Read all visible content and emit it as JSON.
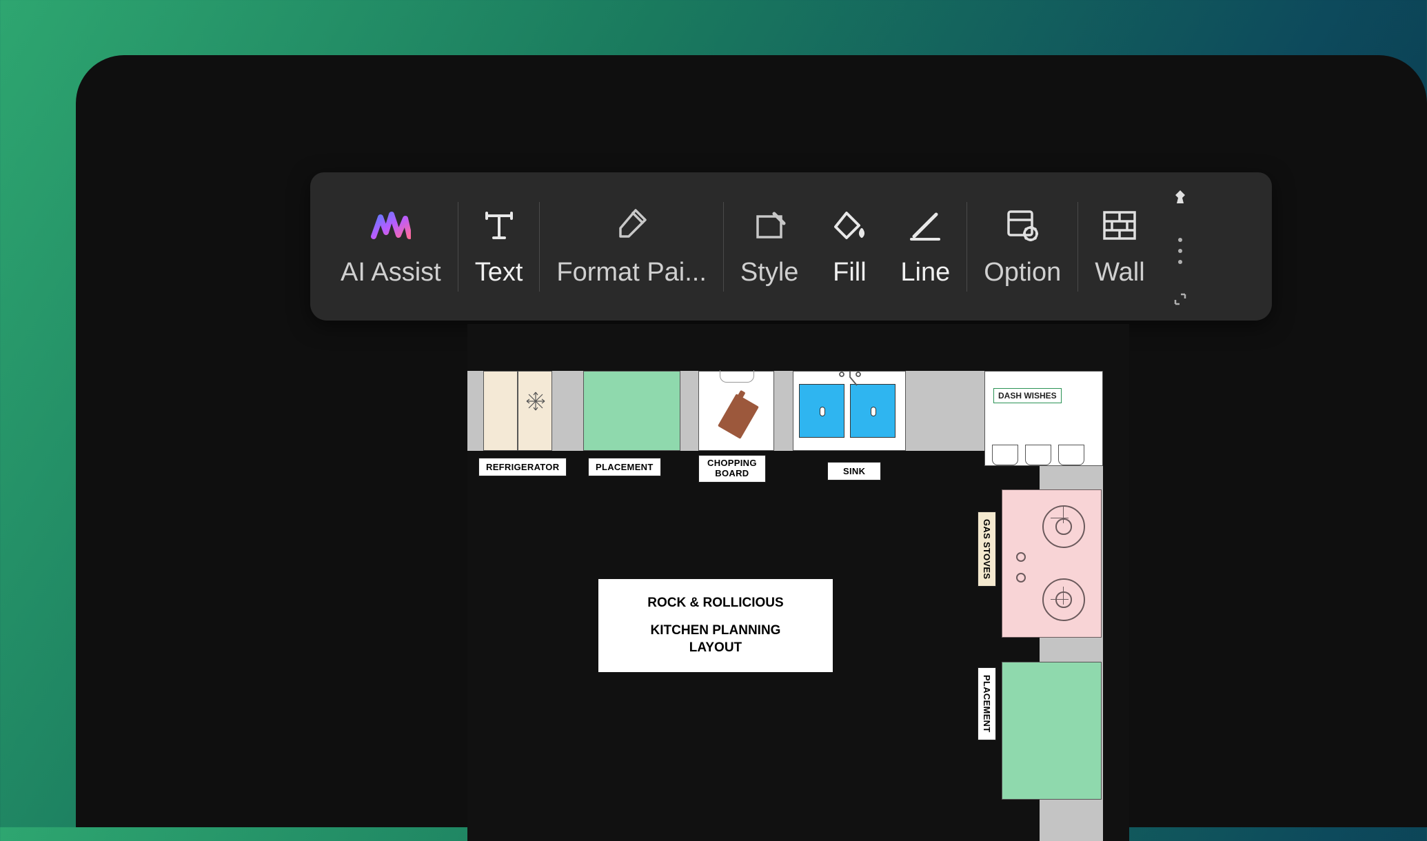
{
  "toolbar": {
    "ai_assist": "AI Assist",
    "text": "Text",
    "format_painter": "Format Pai...",
    "style": "Style",
    "fill": "Fill",
    "line": "Line",
    "option": "Option",
    "wall": "Wall"
  },
  "floorplan": {
    "title_line1": "ROCK & ROLLICIOUS",
    "title_line2": "KITCHEN PLANNING",
    "title_line3": "LAYOUT",
    "labels": {
      "refrigerator": "REFRIGERATOR",
      "placement": "PLACEMENT",
      "chopping_board_l1": "CHOPPING",
      "chopping_board_l2": "BOARD",
      "sink": "SINK",
      "dash_wishes": "DASH WISHES",
      "gas_stoves": "GAS STOVES",
      "placement2": "PLACEMENT"
    }
  }
}
